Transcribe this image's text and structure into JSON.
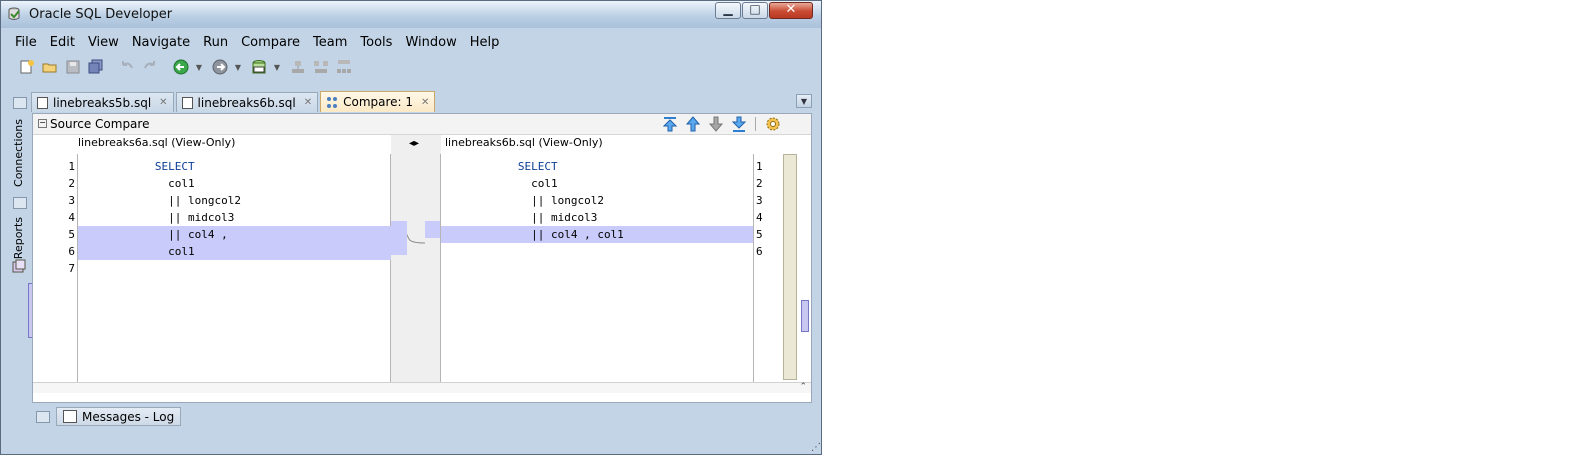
{
  "window": {
    "title": "Oracle SQL Developer",
    "buttons": {
      "minimize": "▁",
      "maximize": "□",
      "close": "✕"
    }
  },
  "menu": [
    "File",
    "Edit",
    "View",
    "Navigate",
    "Run",
    "Compare",
    "Team",
    "Tools",
    "Window",
    "Help"
  ],
  "toolbar": {
    "icons": [
      "new-icon",
      "open-icon",
      "save-icon",
      "save-all-icon",
      "undo-icon",
      "redo-icon",
      "back-icon",
      "forward-icon",
      "sql-worksheet-icon",
      "migration-icon",
      "migration-multi-icon",
      "migration-tree-icon"
    ]
  },
  "tabs": [
    {
      "label": "linebreaks5b.sql",
      "active": false,
      "close": "✕"
    },
    {
      "label": "linebreaks6b.sql",
      "active": false,
      "close": "✕"
    },
    {
      "label": "Compare: 1",
      "active": true,
      "close": "✕"
    }
  ],
  "side_dock": {
    "connections": "Connections",
    "reports": "Reports"
  },
  "panel": {
    "title": "Source Compare",
    "collapse": "−",
    "middle_arrows": "◂▸",
    "left": {
      "header": "linebreaks6a.sql (View-Only)",
      "line_numbers": [
        "1",
        "2",
        "3",
        "4",
        "5",
        "6",
        "7"
      ],
      "lines": [
        "           SELECT",
        "             col1",
        "             || longcol2",
        "             || midcol3",
        "             || col4 ,",
        "             col1",
        ""
      ]
    },
    "right": {
      "header": "linebreaks6b.sql (View-Only)",
      "line_numbers": [
        "1",
        "2",
        "3",
        "4",
        "5",
        "6"
      ],
      "lines": [
        "           SELECT",
        "             col1",
        "             || longcol2",
        "             || midcol3",
        "             || col4 , col1",
        ""
      ]
    },
    "nav_buttons": [
      "first-difference-icon",
      "previous-difference-icon",
      "next-difference-icon",
      "last-difference-icon",
      "settings-icon"
    ],
    "scroll_up": "⌃"
  },
  "messages": {
    "label": "Messages - Log"
  },
  "colors": {
    "diff_highlight": "#c9cbfa",
    "keyword": "#0b3d93",
    "window_frame": "#c2d4e6"
  }
}
